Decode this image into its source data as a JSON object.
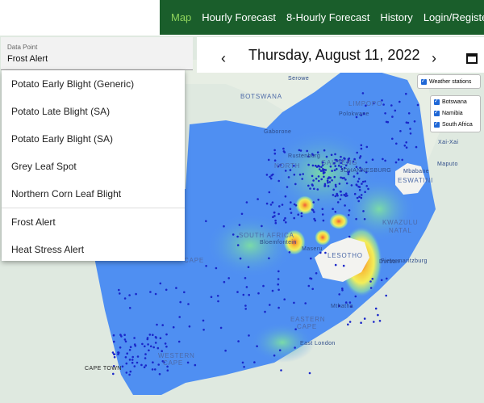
{
  "nav": {
    "items": [
      "Map",
      "Hourly Forecast",
      "8-Hourly Forecast",
      "History",
      "Login/Register"
    ]
  },
  "data_point": {
    "caption": "Data Point",
    "value": "Frost Alert"
  },
  "dropdown": {
    "options": [
      "Potato Early Blight (Generic)",
      "Potato Late Blight (SA)",
      "Potato Early Blight (SA)",
      "Grey Leaf Spot",
      "Northern Corn Leaf Blight",
      "Frost Alert",
      "Heat Stress Alert"
    ]
  },
  "datebar": {
    "prev": "‹",
    "date": "Thursday, August 11, 2022",
    "next": "›"
  },
  "layers": {
    "weather": "Weather stations",
    "countries": [
      "Botswana",
      "Namibia",
      "South Africa"
    ]
  },
  "map_labels": {
    "botswana": "BOTSWANA",
    "limpopo": "LIMPOPO",
    "serowe": "Serowe",
    "polokwane": "Polokwane",
    "gaborone": "Gaborone",
    "rustenburg": "Rustenburg",
    "north": "NORTH",
    "gauteng": "GAUTENG",
    "johannesburg": "JOHANNESBURG",
    "maputo": "Maputo",
    "xaixai": "Xai-Xai",
    "mbabane": "Mbabane",
    "eswatini": "ESWATINI",
    "kwazulu": "KWAZULU",
    "natal": "NATAL",
    "southafrica": "SOUTH AFRICA",
    "lesotho": "LESOTHO",
    "bloemfontein": "Bloemfontein",
    "maseru": "Maseru",
    "durban": "Durban",
    "pietermaritzburg": "Pietermaritzburg",
    "cape": "CAPE",
    "mthatha": "Mthatha",
    "eastern": "EASTERN",
    "ecape": "CAPE",
    "eastlondon": "East London",
    "western": "WESTERN",
    "wcape": "CAPE",
    "capetown": "CAPE TOWN"
  }
}
